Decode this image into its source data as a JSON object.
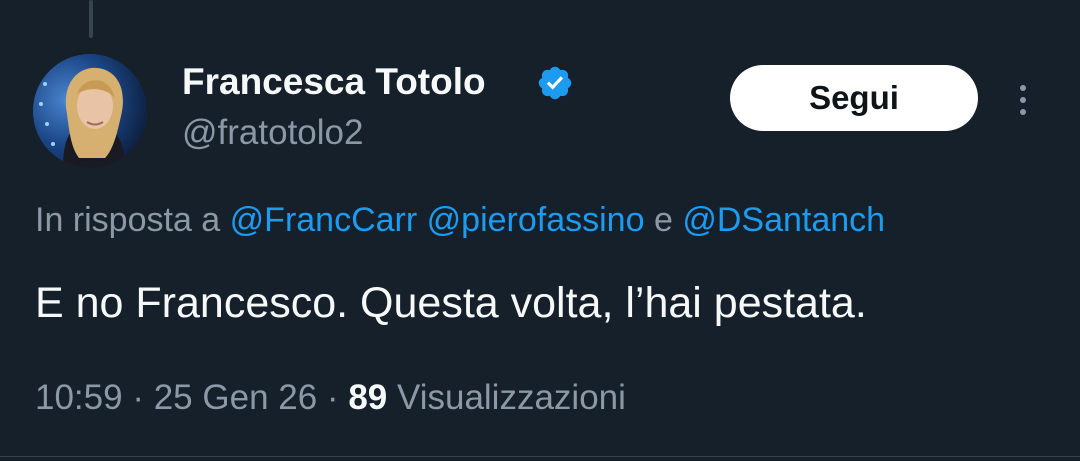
{
  "author": {
    "name": "Francesca Totolo",
    "handle": "@fratotolo2",
    "verified": true,
    "verified_icon": "verified-badge-icon",
    "avatar_icon": "profile-photo"
  },
  "actions": {
    "follow_label": "Segui",
    "more_icon": "more-vertical-icon"
  },
  "reply": {
    "prefix": "In risposta a",
    "mentions": [
      "@FrancCarr",
      "@pierofassino",
      "@DSantanch"
    ],
    "conjunction": "e"
  },
  "tweet": {
    "text": "E no Francesco. Questa volta, l’hai pestata."
  },
  "meta": {
    "time": "10:59",
    "separator": "·",
    "date": "25 Gen 26",
    "views_count": "89",
    "views_label": "Visualizzazioni"
  },
  "colors": {
    "background": "#15202b",
    "accent": "#1d9bf0",
    "muted": "#8b98a5",
    "text": "#f7f9f9",
    "button_bg": "#ffffff"
  }
}
